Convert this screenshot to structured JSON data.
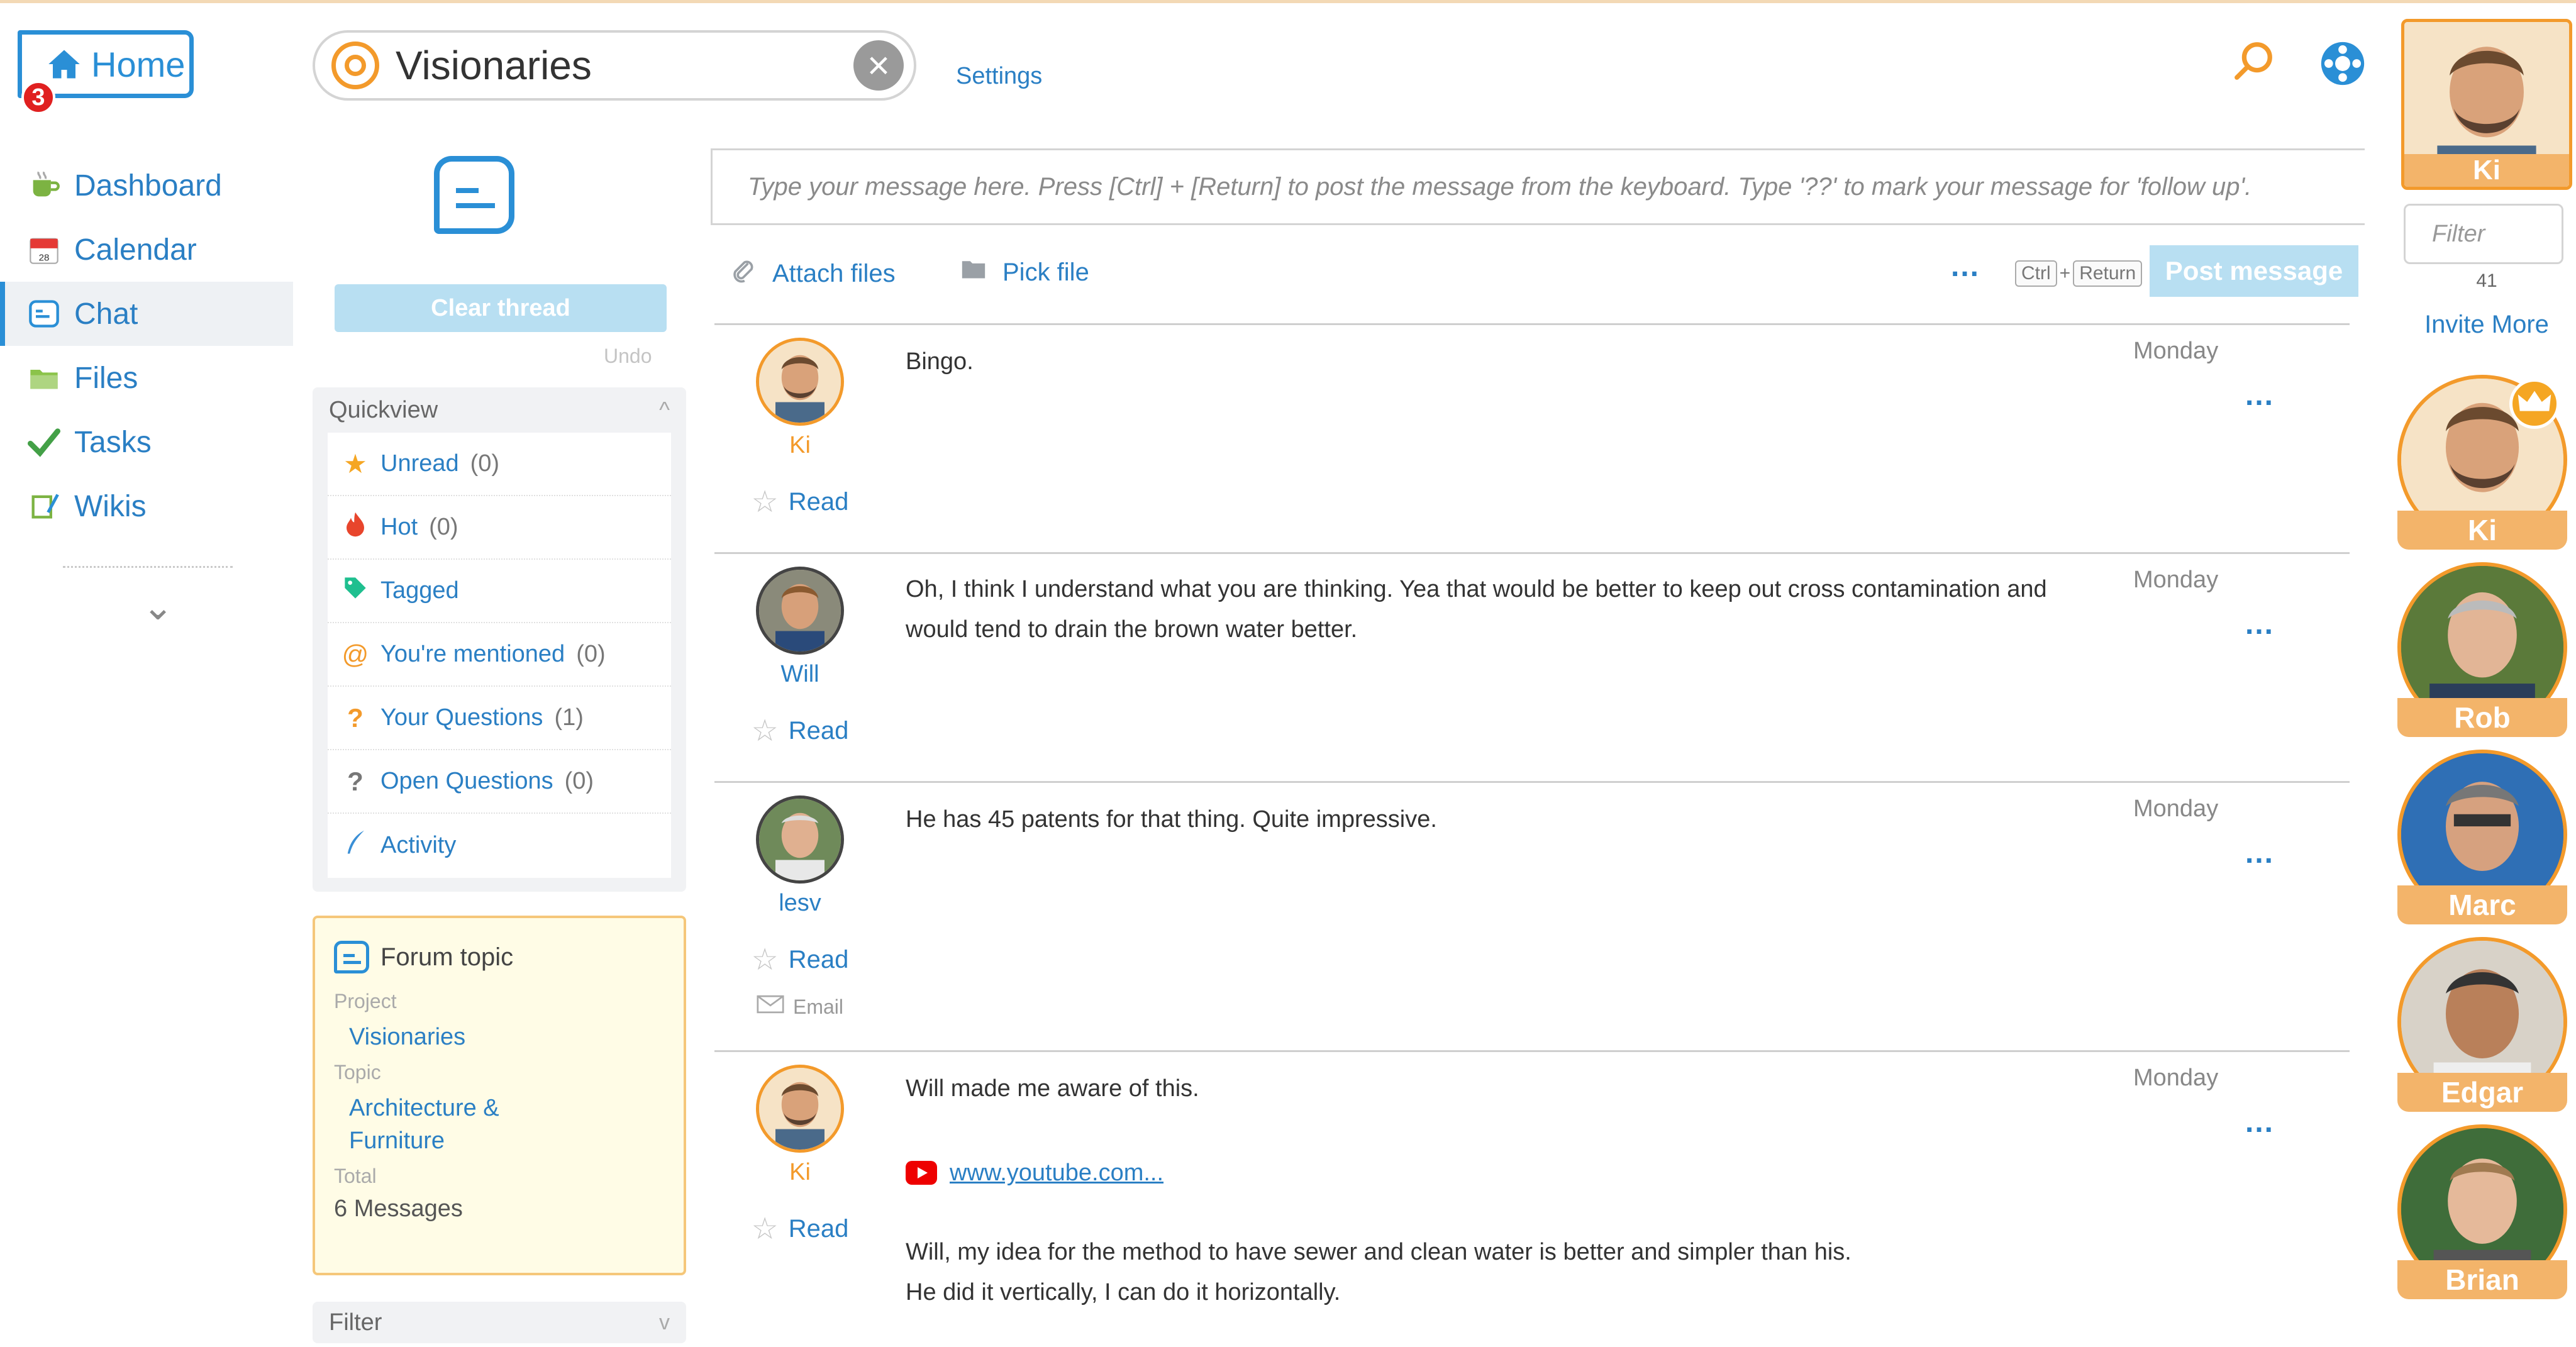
{
  "app": {
    "home_label": "Home",
    "home_badge": "3",
    "settings_label": "Settings"
  },
  "nav": {
    "items": [
      {
        "label": "Dashboard",
        "icon": "cup-icon"
      },
      {
        "label": "Calendar",
        "icon": "calendar-icon"
      },
      {
        "label": "Chat",
        "icon": "chat-icon",
        "active": true
      },
      {
        "label": "Files",
        "icon": "folder-icon"
      },
      {
        "label": "Tasks",
        "icon": "checkmark-icon"
      },
      {
        "label": "Wikis",
        "icon": "wiki-icon"
      }
    ]
  },
  "search": {
    "value": "Visionaries"
  },
  "thread": {
    "clear_label": "Clear thread",
    "undo_label": "Undo"
  },
  "quickview": {
    "title": "Quickview",
    "items": [
      {
        "label": "Unread",
        "count": "(0)",
        "icon": "star-icon",
        "color": "#f5a623"
      },
      {
        "label": "Hot",
        "count": "(0)",
        "icon": "flame-icon",
        "color": "#e8452c"
      },
      {
        "label": "Tagged",
        "count": "",
        "icon": "tag-icon",
        "color": "#1fbf8f"
      },
      {
        "label": "You're mentioned",
        "count": "(0)",
        "icon": "at-icon",
        "color": "#f39a2b"
      },
      {
        "label": "Your Questions",
        "count": "(1)",
        "icon": "question-icon",
        "color": "#f39a2b"
      },
      {
        "label": "Open Questions",
        "count": "(0)",
        "icon": "question-icon",
        "color": "#777777"
      },
      {
        "label": "Activity",
        "count": "",
        "icon": "feather-icon",
        "color": "#3a8fd6"
      }
    ]
  },
  "forum_card": {
    "title": "Forum topic",
    "project_label": "Project",
    "project_value": "Visionaries",
    "topic_label": "Topic",
    "topic_value": "Architecture & Furniture",
    "total_label": "Total",
    "total_value": "6 Messages"
  },
  "filter_bar": {
    "label": "Filter"
  },
  "composer": {
    "placeholder": "Type your message here. Press [Ctrl] + [Return] to post the message from the keyboard. Type '??' to mark your message for 'follow up'.",
    "attach_label": "Attach files",
    "pick_label": "Pick file",
    "more_label": "...",
    "kbd_ctrl": "Ctrl",
    "kbd_plus": "+",
    "kbd_return": "Return",
    "post_label": "Post message"
  },
  "messages": [
    {
      "author": "Ki",
      "author_color": "#f39a2b",
      "text": "Bingo.",
      "time": "Monday",
      "read_label": "Read",
      "dots": "...",
      "avatar_style": "orange"
    },
    {
      "author": "Will",
      "author_color": "#2a7fc4",
      "text": "Oh, I think I understand what you are thinking.  Yea that would be better to keep out cross contamination and would tend to drain the brown water better.",
      "time": "Monday",
      "read_label": "Read",
      "dots": "...",
      "avatar_style": "grey"
    },
    {
      "author": "lesv",
      "author_color": "#2a7fc4",
      "text": "He has 45 patents for that thing.  Quite impressive.",
      "time": "Monday",
      "read_label": "Read",
      "dots": "...",
      "avatar_style": "grey",
      "email_label": "Email"
    },
    {
      "author": "Ki",
      "author_color": "#f39a2b",
      "text": "Will made me aware of this.",
      "time": "Monday",
      "read_label": "Read",
      "dots": "...",
      "avatar_style": "orange",
      "link_text": "www.youtube.com...",
      "extra_text_1": "Will, my idea for the method to have sewer and clean water is better and simpler than his.",
      "extra_text_2": "He did it vertically, I can do it horizontally."
    }
  ],
  "users_panel": {
    "me_name": "Ki",
    "filter_placeholder": "Filter",
    "count": "41",
    "invite_label": "Invite More",
    "users": [
      {
        "name": "Ki",
        "style": "orange"
      },
      {
        "name": "Rob",
        "style": "green"
      },
      {
        "name": "Marc",
        "style": "dark"
      },
      {
        "name": "Edgar",
        "style": "orange"
      },
      {
        "name": "Brian",
        "style": "green"
      }
    ]
  }
}
